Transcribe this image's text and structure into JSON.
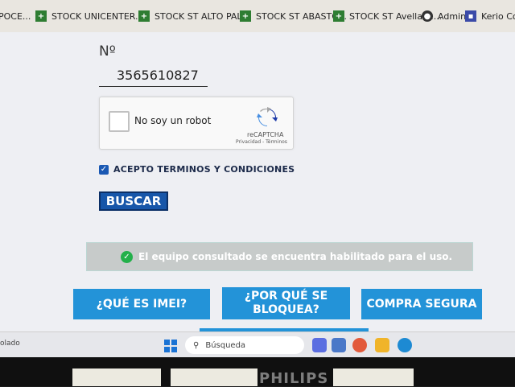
{
  "bookmarks": [
    {
      "label": "POCE...",
      "icon": "none"
    },
    {
      "label": "STOCK UNICENTER...",
      "icon": "spreadsheet-icon"
    },
    {
      "label": "STOCK ST ALTO PAL...",
      "icon": "spreadsheet-icon"
    },
    {
      "label": "STOCK ST ABASTO...",
      "icon": "spreadsheet-icon"
    },
    {
      "label": "STOCK ST Avellane...",
      "icon": "spreadsheet-icon"
    },
    {
      "label": "Admin",
      "icon": "globe-icon"
    },
    {
      "label": "Kerio Conne",
      "icon": "kerio-icon"
    }
  ],
  "form": {
    "number_label": "Nº",
    "imei_value": "3565610827",
    "captcha_text": "No soy un robot",
    "captcha_brand": "reCAPTCHA",
    "captcha_links": "Privacidad - Términos",
    "terms_label": "ACEPTO TERMINOS Y CONDICIONES",
    "terms_checked": true,
    "search_button": "BUSCAR"
  },
  "result": {
    "message": "El equipo consultado se encuentra habilitado para el uso.",
    "status_color": "#23b04a"
  },
  "cta_buttons": [
    "¿QUÉ ES IMEI?",
    "¿POR QUÉ SE BLOQUEA?",
    "COMPRA SEGURA"
  ],
  "taskbar": {
    "left_text": "olado",
    "search_placeholder": "Búsqueda"
  },
  "monitor": {
    "brand": "PHILIPS"
  },
  "colors": {
    "accent_blue": "#2393d8",
    "button_dark_blue": "#1756a9",
    "page_bg": "#eeeff3"
  }
}
